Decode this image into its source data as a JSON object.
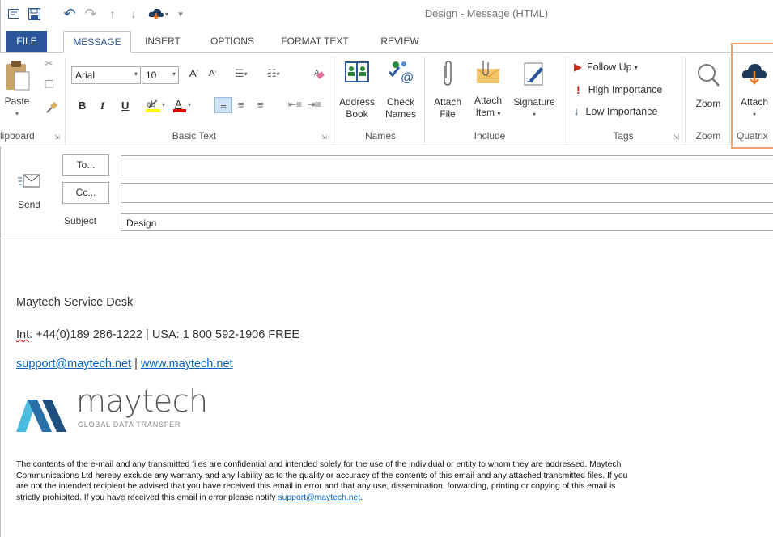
{
  "window": {
    "title": "Design  -  Message (HTML)"
  },
  "qat": {
    "icons": [
      "outlook-icon",
      "save-icon",
      "undo-icon",
      "redo-icon",
      "up-icon",
      "down-icon",
      "attach-cloud-icon",
      "customize-icon"
    ]
  },
  "tabs": [
    "FILE",
    "MESSAGE",
    "INSERT",
    "OPTIONS",
    "FORMAT TEXT",
    "REVIEW"
  ],
  "ribbon": {
    "clipboard": {
      "paste": "Paste",
      "label": "lipboard"
    },
    "basic_text": {
      "font": "Arial",
      "size": "10",
      "bold": "B",
      "italic": "I",
      "underline": "U",
      "label": "Basic Text"
    },
    "names": {
      "address_book_1": "Address",
      "address_book_2": "Book",
      "check_names_1": "Check",
      "check_names_2": "Names",
      "label": "Names"
    },
    "include": {
      "attach_file_1": "Attach",
      "attach_file_2": "File",
      "attach_item_1": "Attach",
      "attach_item_2": "Item",
      "signature": "Signature",
      "label": "Include"
    },
    "tags": {
      "follow_up": "Follow Up",
      "high": "High Importance",
      "low": "Low Importance",
      "label": "Tags"
    },
    "zoom": {
      "button": "Zoom",
      "label": "Zoom"
    },
    "quatrix": {
      "button": "Attach",
      "label": "Quatrix"
    }
  },
  "compose": {
    "send": "Send",
    "to": "To...",
    "cc": "Cc...",
    "subject_label": "Subject",
    "subject_value": "Design"
  },
  "body": {
    "line1": "Maytech Service Desk",
    "line2_int": "Int",
    "line2_rest": ": +44(0)189 286-1222 | USA: 1 800 592-1906 FREE",
    "email": "support@maytech.net",
    "sep": " | ",
    "web": "www.maytech.net",
    "logo_word": "maytech",
    "logo_tag": "GLOBAL DATA TRANSFER",
    "disclaimer": "The contents of the e-mail and any transmitted files are confidential and intended solely for the use of the individual or entity to whom they are addressed. Maytech Communications Ltd hereby exclude any warranty and any liability as to the quality or accuracy of the contents of this email and any attached transmitted files. If you are not the intended recipient be advised that you have received this email in error and that any use, dissemination, forwarding, printing or copying of this email is strictly prohibited. If you have received this email in error please notify ",
    "disclaimer_link": "support@maytech.net",
    "disclaimer_end": "."
  },
  "colors": {
    "accent": "#2b579a",
    "highlight_box": "#f0a070",
    "link": "#0563c1",
    "logo_blue": "#2a6fa8",
    "logo_cyan": "#4bbbe0"
  }
}
